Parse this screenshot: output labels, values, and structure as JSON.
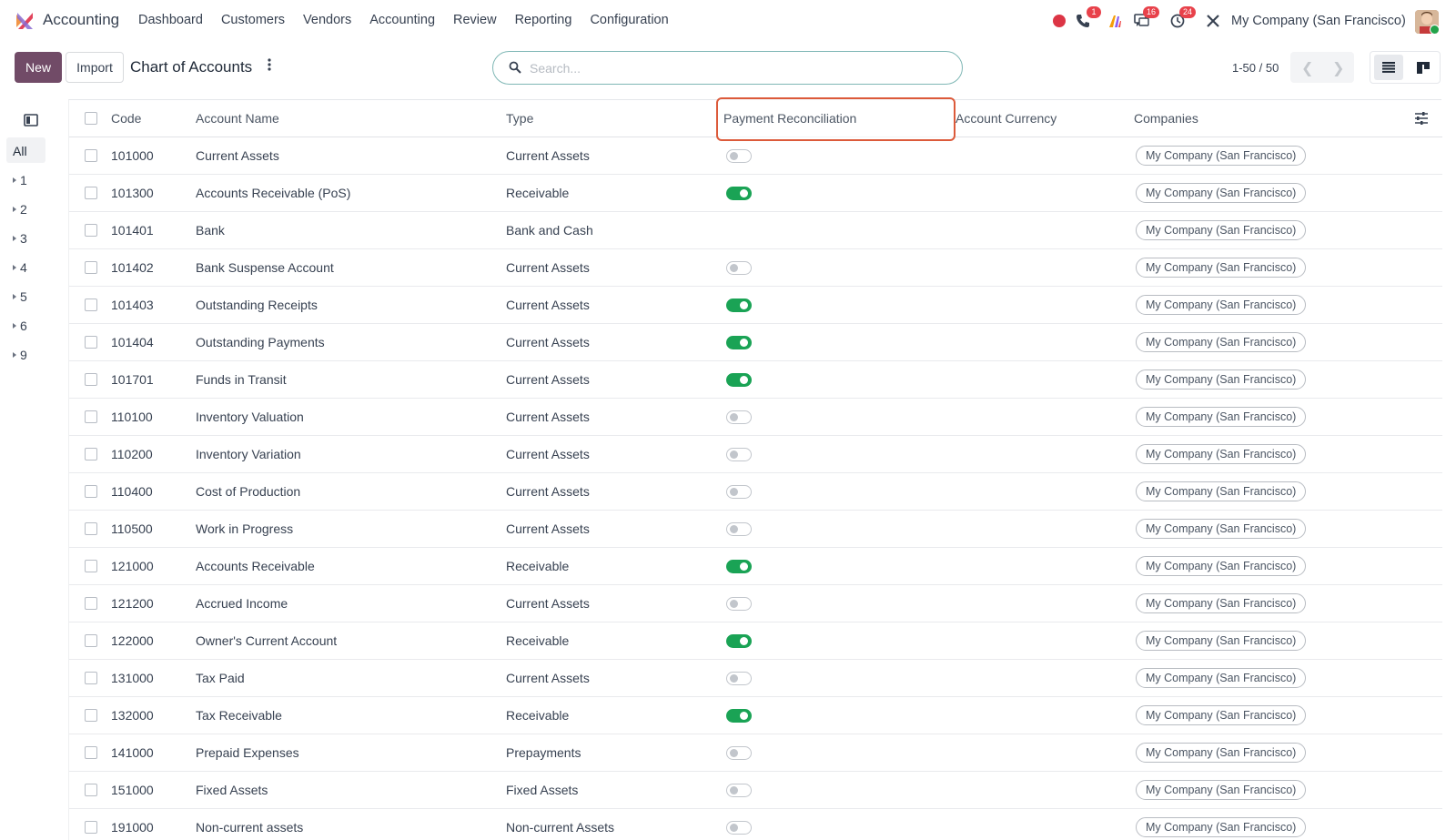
{
  "app": {
    "name": "Accounting"
  },
  "menu": [
    "Dashboard",
    "Customers",
    "Vendors",
    "Accounting",
    "Review",
    "Reporting",
    "Configuration"
  ],
  "systray": {
    "phone_badge": "1",
    "messages_badge": "16",
    "activities_badge": "24",
    "company": "My Company (San Francisco)"
  },
  "control": {
    "new_label": "New",
    "import_label": "Import",
    "title": "Chart of Accounts",
    "search_placeholder": "Search...",
    "pager": "1-50 / 50"
  },
  "side_panel": {
    "all_label": "All",
    "groups": [
      "1",
      "2",
      "3",
      "4",
      "5",
      "6",
      "9"
    ]
  },
  "columns": {
    "code": "Code",
    "name": "Account Name",
    "type": "Type",
    "reconcile": "Payment Reconciliation",
    "currency": "Account Currency",
    "companies": "Companies"
  },
  "rows": [
    {
      "code": "101000",
      "name": "Current Assets",
      "type": "Current Assets",
      "reconcile": "off",
      "company": "My Company (San Francisco)"
    },
    {
      "code": "101300",
      "name": "Accounts Receivable (PoS)",
      "type": "Receivable",
      "reconcile": "on",
      "company": "My Company (San Francisco)"
    },
    {
      "code": "101401",
      "name": "Bank",
      "type": "Bank and Cash",
      "reconcile": "none",
      "company": "My Company (San Francisco)"
    },
    {
      "code": "101402",
      "name": "Bank Suspense Account",
      "type": "Current Assets",
      "reconcile": "off",
      "company": "My Company (San Francisco)"
    },
    {
      "code": "101403",
      "name": "Outstanding Receipts",
      "type": "Current Assets",
      "reconcile": "on",
      "company": "My Company (San Francisco)"
    },
    {
      "code": "101404",
      "name": "Outstanding Payments",
      "type": "Current Assets",
      "reconcile": "on",
      "company": "My Company (San Francisco)"
    },
    {
      "code": "101701",
      "name": "Funds in Transit",
      "type": "Current Assets",
      "reconcile": "on",
      "company": "My Company (San Francisco)"
    },
    {
      "code": "110100",
      "name": "Inventory Valuation",
      "type": "Current Assets",
      "reconcile": "off",
      "company": "My Company (San Francisco)"
    },
    {
      "code": "110200",
      "name": "Inventory Variation",
      "type": "Current Assets",
      "reconcile": "off",
      "company": "My Company (San Francisco)"
    },
    {
      "code": "110400",
      "name": "Cost of Production",
      "type": "Current Assets",
      "reconcile": "off",
      "company": "My Company (San Francisco)"
    },
    {
      "code": "110500",
      "name": "Work in Progress",
      "type": "Current Assets",
      "reconcile": "off",
      "company": "My Company (San Francisco)"
    },
    {
      "code": "121000",
      "name": "Accounts Receivable",
      "type": "Receivable",
      "reconcile": "on",
      "company": "My Company (San Francisco)"
    },
    {
      "code": "121200",
      "name": "Accrued Income",
      "type": "Current Assets",
      "reconcile": "off",
      "company": "My Company (San Francisco)"
    },
    {
      "code": "122000",
      "name": "Owner's Current Account",
      "type": "Receivable",
      "reconcile": "on",
      "company": "My Company (San Francisco)"
    },
    {
      "code": "131000",
      "name": "Tax Paid",
      "type": "Current Assets",
      "reconcile": "off",
      "company": "My Company (San Francisco)"
    },
    {
      "code": "132000",
      "name": "Tax Receivable",
      "type": "Receivable",
      "reconcile": "on",
      "company": "My Company (San Francisco)"
    },
    {
      "code": "141000",
      "name": "Prepaid Expenses",
      "type": "Prepayments",
      "reconcile": "off",
      "company": "My Company (San Francisco)"
    },
    {
      "code": "151000",
      "name": "Fixed Assets",
      "type": "Fixed Assets",
      "reconcile": "off",
      "company": "My Company (San Francisco)"
    },
    {
      "code": "191000",
      "name": "Non-current assets",
      "type": "Non-current Assets",
      "reconcile": "off",
      "company": "My Company (San Francisco)"
    }
  ],
  "colors": {
    "brand": "#714b67",
    "toggle_on": "#1aa355",
    "highlight": "#dc5a3a",
    "badge": "#e8414a"
  }
}
